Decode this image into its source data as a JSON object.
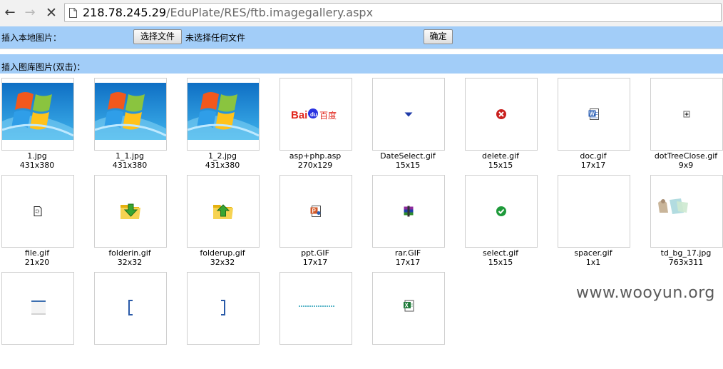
{
  "browser": {
    "url_host": "218.78.245.29",
    "url_path": "/EduPlate/RES/ftb.imagegallery.aspx",
    "back_glyph": "←",
    "forward_glyph": "→",
    "stop_glyph": "✕"
  },
  "upload": {
    "label": "插入本地图片：",
    "choose_button": "选择文件",
    "no_file_text": "未选择任何文件",
    "ok_button": "确定"
  },
  "gallery": {
    "label": "插入图库图片(双击)：",
    "images": [
      {
        "name": "1.jpg",
        "size": "431x380",
        "icon": "windows7-wallpaper"
      },
      {
        "name": "1_1.jpg",
        "size": "431x380",
        "icon": "windows7-wallpaper"
      },
      {
        "name": "1_2.jpg",
        "size": "431x380",
        "icon": "windows7-wallpaper"
      },
      {
        "name": "asp+php.asp",
        "size": "270x129",
        "icon": "baidu-logo",
        "logo_text": "百度"
      },
      {
        "name": "DateSelect.gif",
        "size": "15x15",
        "icon": "dropdown-arrow-icon"
      },
      {
        "name": "delete.gif",
        "size": "15x15",
        "icon": "delete-icon"
      },
      {
        "name": "doc.gif",
        "size": "17x17",
        "icon": "word-doc-icon"
      },
      {
        "name": "dotTreeClose.gif",
        "size": "9x9",
        "icon": "tree-expand-icon"
      },
      {
        "name": "file.gif",
        "size": "21x20",
        "icon": "file-icon"
      },
      {
        "name": "folderin.gif",
        "size": "32x32",
        "icon": "folder-in-icon"
      },
      {
        "name": "folderup.gif",
        "size": "32x32",
        "icon": "folder-up-icon"
      },
      {
        "name": "ppt.GIF",
        "size": "17x17",
        "icon": "powerpoint-icon"
      },
      {
        "name": "rar.GIF",
        "size": "17x17",
        "icon": "rar-archive-icon"
      },
      {
        "name": "select.gif",
        "size": "15x15",
        "icon": "check-icon"
      },
      {
        "name": "spacer.gif",
        "size": "1x1",
        "icon": "blank"
      },
      {
        "name": "td_bg_17.jpg",
        "size": "763x311",
        "icon": "background-thumbnail"
      },
      {
        "icon": "table-edge-thumbnail"
      },
      {
        "icon": "left-bracket-thumbnail"
      },
      {
        "icon": "right-bracket-thumbnail"
      },
      {
        "icon": "text-banner-thumbnail"
      },
      {
        "icon": "excel-icon"
      }
    ]
  },
  "watermark": "www.wooyun.org",
  "colors": {
    "bar": "#a2cdf8",
    "delete_red": "#c9201e",
    "check_green": "#1e9a3a",
    "folder_yellow": "#f2c62e"
  }
}
